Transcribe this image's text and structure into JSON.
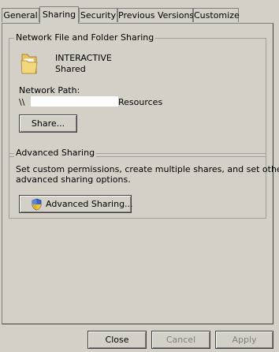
{
  "tabs": [
    {
      "label": "General",
      "active": false
    },
    {
      "label": "Sharing",
      "active": true
    },
    {
      "label": "Security",
      "active": false
    },
    {
      "label": "Previous Versions",
      "active": false
    },
    {
      "label": "Customize",
      "active": false
    }
  ],
  "network_sharing": {
    "legend": "Network File and Folder Sharing",
    "folder_name": "INTERACTIVE",
    "folder_status": "Shared",
    "network_path_label": "Network Path:",
    "network_path_prefix": "\\\\",
    "network_path_suffix": "Resources",
    "share_button": "Share..."
  },
  "advanced_sharing": {
    "legend": "Advanced Sharing",
    "description_line1": "Set custom permissions, create multiple shares, and set other",
    "description_line2": "advanced sharing options.",
    "button": "Advanced Sharing..."
  },
  "footer": {
    "close": "Close",
    "cancel": "Cancel",
    "apply": "Apply"
  },
  "icons": {
    "folder": "shared-folder-icon",
    "shield": "uac-shield-icon"
  }
}
